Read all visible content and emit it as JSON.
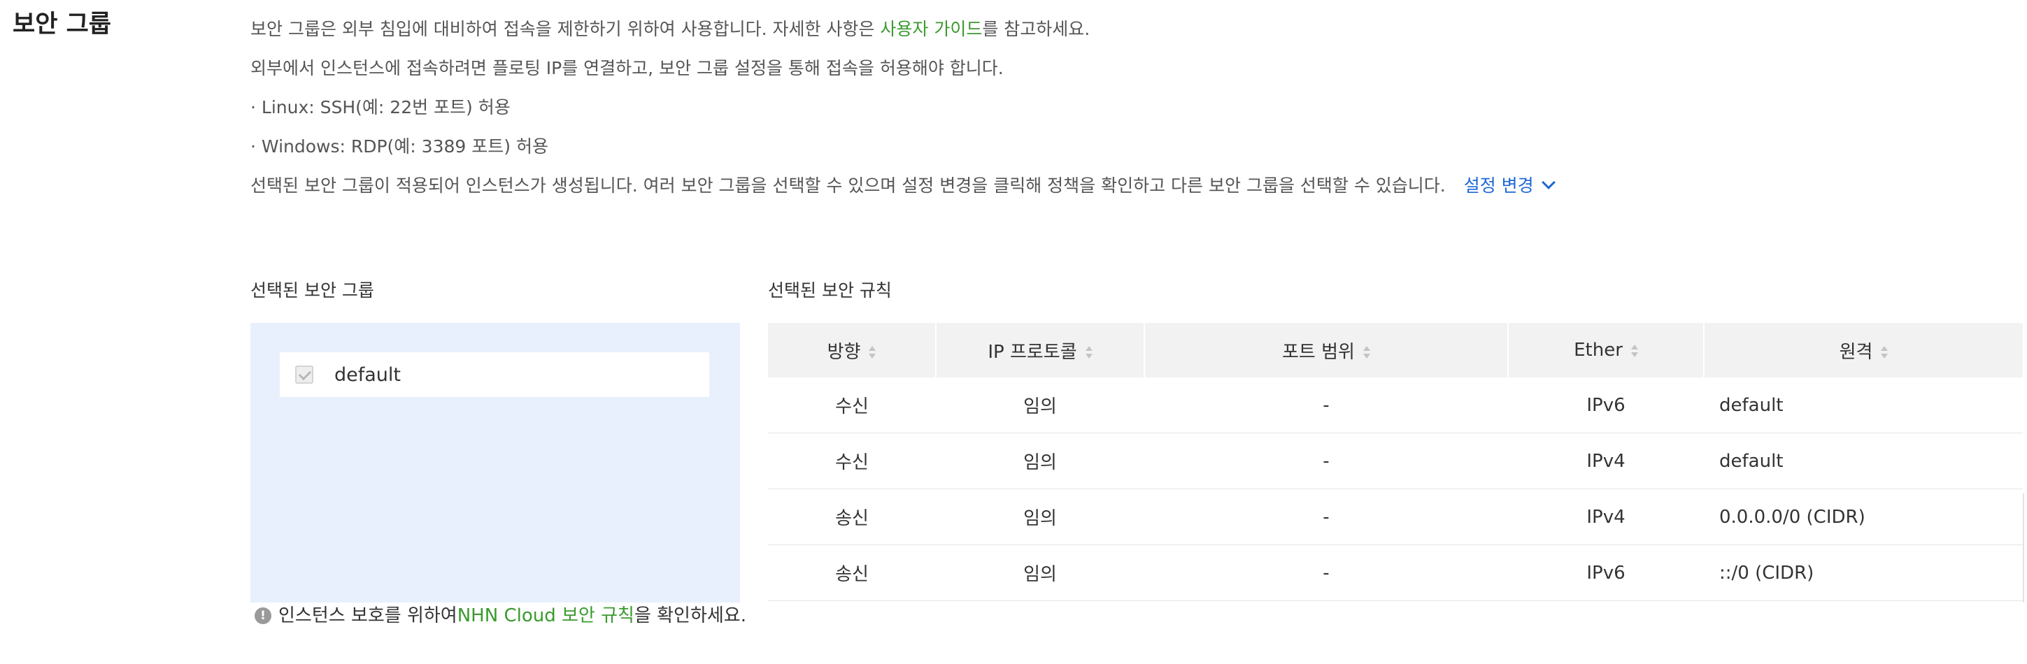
{
  "section_title": "보안 그룹",
  "description": {
    "line1_before": "보안 그룹은 외부 침입에 대비하여 접속을 제한하기 위하여 사용합니다. 자세한 사항은 ",
    "line1_link": "사용자 가이드",
    "line1_after": "를 참고하세요.",
    "line2": "외부에서 인스턴스에 접속하려면 플로팅 IP를 연결하고, 보안 그룹 설정을 통해 접속을 허용해야 합니다.",
    "line3": "· Linux: SSH(예: 22번 포트) 허용",
    "line4": "· Windows: RDP(예: 3389 포트) 허용",
    "line5": "선택된 보안 그룹이 적용되어 인스턴스가 생성됩니다. 여러 보안 그룹을 선택할 수 있으며 설정 변경을 클릭해 정책을 확인하고 다른 보안 그룹을 선택할 수 있습니다.",
    "settings_change": "설정 변경"
  },
  "selected_groups": {
    "label": "선택된 보안 그룹",
    "items": [
      {
        "name": "default",
        "checked": true
      }
    ]
  },
  "selected_rules": {
    "label": "선택된 보안 규칙",
    "columns": [
      "방향",
      "IP 프로토콜",
      "포트 범위",
      "Ether",
      "원격"
    ],
    "rows": [
      {
        "direction": "수신",
        "protocol": "임의",
        "port_range": "-",
        "ether": "IPv6",
        "remote": "default"
      },
      {
        "direction": "수신",
        "protocol": "임의",
        "port_range": "-",
        "ether": "IPv4",
        "remote": "default"
      },
      {
        "direction": "송신",
        "protocol": "임의",
        "port_range": "-",
        "ether": "IPv4",
        "remote": "0.0.0.0/0 (CIDR)"
      },
      {
        "direction": "송신",
        "protocol": "임의",
        "port_range": "-",
        "ether": "IPv6",
        "remote": "::/0 (CIDR)"
      }
    ]
  },
  "notice": {
    "icon": "!",
    "before": "인스턴스 보호를 위하여 ",
    "link": "NHN Cloud 보안 규칙",
    "after": "을 확인하세요."
  },
  "colors": {
    "link_green": "#3a9a2d",
    "link_blue": "#1f67d6",
    "panel_bg": "#e9f0fd",
    "header_bg": "#f2f2f2"
  }
}
